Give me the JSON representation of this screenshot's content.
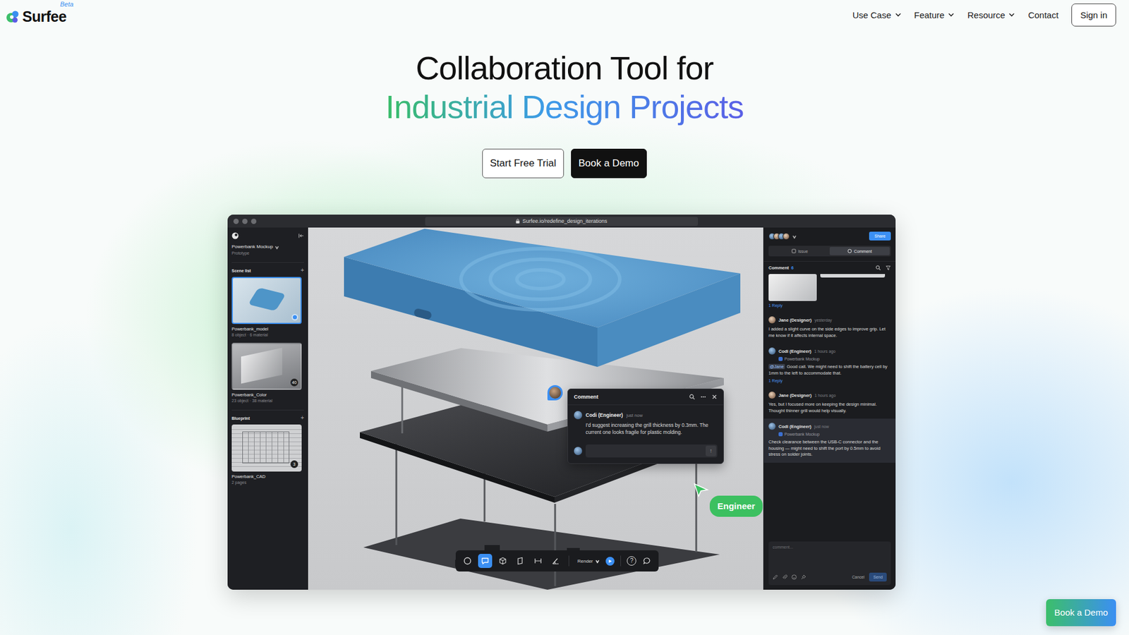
{
  "nav": {
    "logo": "Surfee",
    "logo_badge": "Beta",
    "items": [
      {
        "label": "Use Case",
        "dropdown": true
      },
      {
        "label": "Feature",
        "dropdown": true
      },
      {
        "label": "Resource",
        "dropdown": true
      },
      {
        "label": "Contact",
        "dropdown": false
      }
    ],
    "sign_in": "Sign in"
  },
  "hero": {
    "title": "Collaboration Tool for",
    "highlight": "Industrial Design Projects",
    "buttons": [
      {
        "label": "Start Free Trial",
        "kind": "outline"
      },
      {
        "label": "Book a Demo",
        "kind": "solid"
      }
    ]
  },
  "app": {
    "url": "Surfee.io/redefine_design_iterations",
    "sidebar": {
      "project": "Powerbank Mockup",
      "project_type": "Prototype",
      "sections": [
        {
          "title": "Scene list",
          "add": "+",
          "cards": [
            {
              "name": "Powerbank_model",
              "meta": "8 object · 6 material",
              "kind": "model",
              "selected": true
            },
            {
              "name": "Powerbank_Color",
              "meta": "23 object · 38 material",
              "kind": "color",
              "badge": "40",
              "selected": false
            }
          ]
        },
        {
          "title": "Blueprint",
          "add": "+",
          "cards": [
            {
              "name": "Powerbank_CAD",
              "meta": "2 pages",
              "kind": "cad",
              "badge": "3",
              "selected": false
            }
          ]
        }
      ]
    },
    "canvas": {
      "popup": {
        "title": "Comment",
        "author": "Codi (Engineer)",
        "time": "just now",
        "text": "I'd suggest increasing the grill thickness by 0.3mm. The current one looks fragile for plastic molding.",
        "send": "↑"
      },
      "cursor_label": "Engineer",
      "toolbar": {
        "tools": [
          {
            "kind": "orbit",
            "selected": false
          },
          {
            "kind": "comment",
            "selected": true
          },
          {
            "kind": "cube",
            "selected": false
          },
          {
            "kind": "plane",
            "selected": false
          },
          {
            "kind": "measure",
            "selected": false
          },
          {
            "kind": "angle",
            "selected": false
          }
        ],
        "render": "Render",
        "help": "?"
      }
    },
    "panel": {
      "share": "Share",
      "tabs": [
        {
          "label": "Issue",
          "selected": false
        },
        {
          "label": "Comment",
          "selected": true
        }
      ],
      "comments_title": "Comment",
      "comments_count": "6",
      "comments": [
        {
          "kind": "image",
          "replies": "1 Reply",
          "selected": false
        },
        {
          "kind": "text",
          "author": "Jane (Designer)",
          "time": "yesterday",
          "text": "I added a slight curve on the side edges to improve grip. Let me know if it affects internal space.",
          "selected": false
        },
        {
          "kind": "text",
          "author": "Codi (Engineer)",
          "time": "1 hours ago",
          "tag": "Powerbank Mockup",
          "mention": "@Jane",
          "text": "Good call. We might need to shift the battery cell by 1mm to the left to accommodate that.",
          "replies": "1 Reply",
          "selected": false
        },
        {
          "kind": "text",
          "author": "Jane (Designer)",
          "time": "1 hours ago",
          "text": "Yes, but I focused more on keeping the design minimal. Thought thinner grill would help visually.",
          "selected": false
        },
        {
          "kind": "text",
          "author": "Codi (Engineer)",
          "time": "just now",
          "tag": "Powerbank Mockup",
          "text": "Check clearance between the USB-C connector and the housing — might need to shift the port by 0.5mm to avoid stress on solder joints.",
          "selected": true
        }
      ],
      "composer": {
        "placeholder": "comment...",
        "cancel": "Cancel",
        "send": "Send"
      }
    }
  },
  "floating_button": "Book a Demo"
}
